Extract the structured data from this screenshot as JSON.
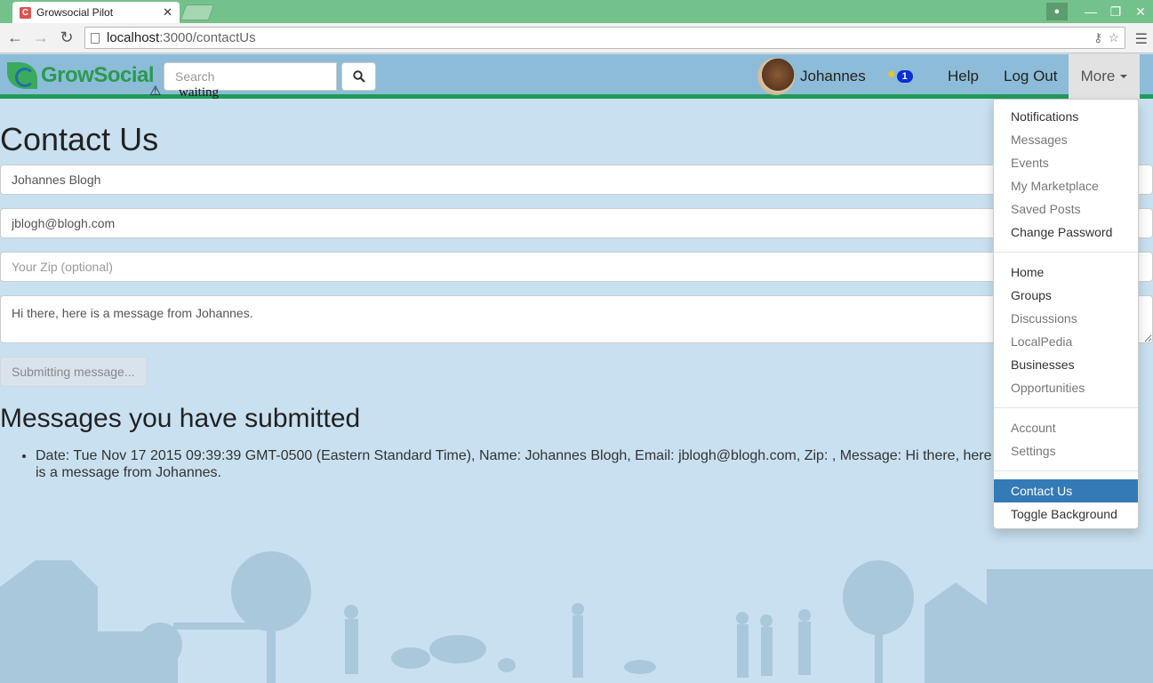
{
  "browser": {
    "tab_title": "Growsocial Pilot",
    "tab_favicon": "C",
    "url_host": "localhost",
    "url_path": ":3000/contactUs"
  },
  "navbar": {
    "logo_text": "GrowSocial",
    "search_placeholder": "Search",
    "status_text": "waiting",
    "username": "Johannes",
    "notification_count": "1",
    "help_label": "Help",
    "logout_label": "Log Out",
    "more_label": "More"
  },
  "page": {
    "title": "Contact Us",
    "form": {
      "name_value": "Johannes Blogh",
      "email_value": "jblogh@blogh.com",
      "zip_placeholder": "Your Zip (optional)",
      "message_value": "Hi there, here is a message from Johannes.",
      "submit_label": "Submitting message..."
    },
    "submitted_title": "Messages you have submitted",
    "submitted_messages": [
      "Date: Tue Nov 17 2015 09:39:39 GMT-0500 (Eastern Standard Time), Name: Johannes Blogh, Email: jblogh@blogh.com, Zip: , Message: Hi there, here is a message from Johannes."
    ]
  },
  "dropdown": {
    "group1": [
      {
        "label": "Notifications",
        "state": "on"
      },
      {
        "label": "Messages",
        "state": "off"
      },
      {
        "label": "Events",
        "state": "off"
      },
      {
        "label": "My Marketplace",
        "state": "off"
      },
      {
        "label": "Saved Posts",
        "state": "off"
      },
      {
        "label": "Change Password",
        "state": "on"
      }
    ],
    "group2": [
      {
        "label": "Home",
        "state": "on"
      },
      {
        "label": "Groups",
        "state": "on"
      },
      {
        "label": "Discussions",
        "state": "off"
      },
      {
        "label": "LocalPedia",
        "state": "off"
      },
      {
        "label": "Businesses",
        "state": "on"
      },
      {
        "label": "Opportunities",
        "state": "off"
      }
    ],
    "group3": [
      {
        "label": "Account",
        "state": "off"
      },
      {
        "label": "Settings",
        "state": "off"
      }
    ],
    "group4": [
      {
        "label": "Contact Us",
        "state": "active"
      },
      {
        "label": "Toggle Background",
        "state": "on"
      }
    ]
  },
  "colors": {
    "tabstrip": "#74c28b",
    "navbar": "#8cbcd8",
    "navbar_border": "#1f9b58",
    "active_item": "#337ab7",
    "badge": "#0a2fd4"
  }
}
